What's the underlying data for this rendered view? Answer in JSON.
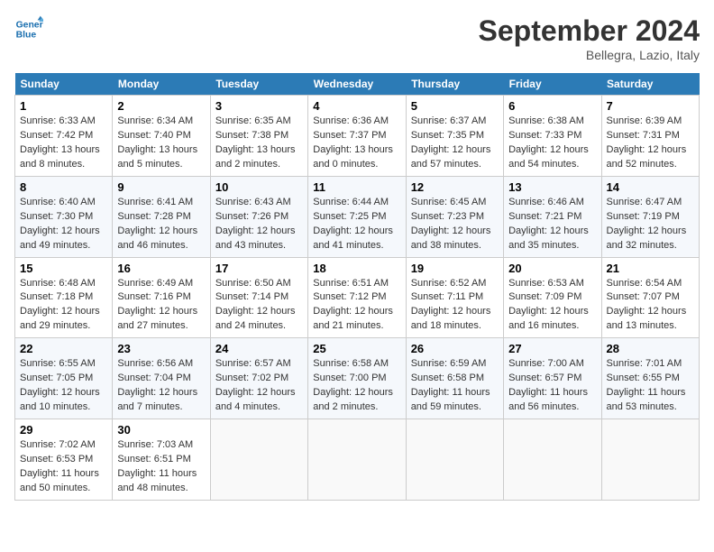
{
  "header": {
    "logo_line1": "General",
    "logo_line2": "Blue",
    "month_title": "September 2024",
    "location": "Bellegra, Lazio, Italy"
  },
  "days_of_week": [
    "Sunday",
    "Monday",
    "Tuesday",
    "Wednesday",
    "Thursday",
    "Friday",
    "Saturday"
  ],
  "weeks": [
    [
      {
        "num": "1",
        "rise": "6:33 AM",
        "set": "7:42 PM",
        "daylight": "13 hours and 8 minutes."
      },
      {
        "num": "2",
        "rise": "6:34 AM",
        "set": "7:40 PM",
        "daylight": "13 hours and 5 minutes."
      },
      {
        "num": "3",
        "rise": "6:35 AM",
        "set": "7:38 PM",
        "daylight": "13 hours and 2 minutes."
      },
      {
        "num": "4",
        "rise": "6:36 AM",
        "set": "7:37 PM",
        "daylight": "13 hours and 0 minutes."
      },
      {
        "num": "5",
        "rise": "6:37 AM",
        "set": "7:35 PM",
        "daylight": "12 hours and 57 minutes."
      },
      {
        "num": "6",
        "rise": "6:38 AM",
        "set": "7:33 PM",
        "daylight": "12 hours and 54 minutes."
      },
      {
        "num": "7",
        "rise": "6:39 AM",
        "set": "7:31 PM",
        "daylight": "12 hours and 52 minutes."
      }
    ],
    [
      {
        "num": "8",
        "rise": "6:40 AM",
        "set": "7:30 PM",
        "daylight": "12 hours and 49 minutes."
      },
      {
        "num": "9",
        "rise": "6:41 AM",
        "set": "7:28 PM",
        "daylight": "12 hours and 46 minutes."
      },
      {
        "num": "10",
        "rise": "6:43 AM",
        "set": "7:26 PM",
        "daylight": "12 hours and 43 minutes."
      },
      {
        "num": "11",
        "rise": "6:44 AM",
        "set": "7:25 PM",
        "daylight": "12 hours and 41 minutes."
      },
      {
        "num": "12",
        "rise": "6:45 AM",
        "set": "7:23 PM",
        "daylight": "12 hours and 38 minutes."
      },
      {
        "num": "13",
        "rise": "6:46 AM",
        "set": "7:21 PM",
        "daylight": "12 hours and 35 minutes."
      },
      {
        "num": "14",
        "rise": "6:47 AM",
        "set": "7:19 PM",
        "daylight": "12 hours and 32 minutes."
      }
    ],
    [
      {
        "num": "15",
        "rise": "6:48 AM",
        "set": "7:18 PM",
        "daylight": "12 hours and 29 minutes."
      },
      {
        "num": "16",
        "rise": "6:49 AM",
        "set": "7:16 PM",
        "daylight": "12 hours and 27 minutes."
      },
      {
        "num": "17",
        "rise": "6:50 AM",
        "set": "7:14 PM",
        "daylight": "12 hours and 24 minutes."
      },
      {
        "num": "18",
        "rise": "6:51 AM",
        "set": "7:12 PM",
        "daylight": "12 hours and 21 minutes."
      },
      {
        "num": "19",
        "rise": "6:52 AM",
        "set": "7:11 PM",
        "daylight": "12 hours and 18 minutes."
      },
      {
        "num": "20",
        "rise": "6:53 AM",
        "set": "7:09 PM",
        "daylight": "12 hours and 16 minutes."
      },
      {
        "num": "21",
        "rise": "6:54 AM",
        "set": "7:07 PM",
        "daylight": "12 hours and 13 minutes."
      }
    ],
    [
      {
        "num": "22",
        "rise": "6:55 AM",
        "set": "7:05 PM",
        "daylight": "12 hours and 10 minutes."
      },
      {
        "num": "23",
        "rise": "6:56 AM",
        "set": "7:04 PM",
        "daylight": "12 hours and 7 minutes."
      },
      {
        "num": "24",
        "rise": "6:57 AM",
        "set": "7:02 PM",
        "daylight": "12 hours and 4 minutes."
      },
      {
        "num": "25",
        "rise": "6:58 AM",
        "set": "7:00 PM",
        "daylight": "12 hours and 2 minutes."
      },
      {
        "num": "26",
        "rise": "6:59 AM",
        "set": "6:58 PM",
        "daylight": "11 hours and 59 minutes."
      },
      {
        "num": "27",
        "rise": "7:00 AM",
        "set": "6:57 PM",
        "daylight": "11 hours and 56 minutes."
      },
      {
        "num": "28",
        "rise": "7:01 AM",
        "set": "6:55 PM",
        "daylight": "11 hours and 53 minutes."
      }
    ],
    [
      {
        "num": "29",
        "rise": "7:02 AM",
        "set": "6:53 PM",
        "daylight": "11 hours and 50 minutes."
      },
      {
        "num": "30",
        "rise": "7:03 AM",
        "set": "6:51 PM",
        "daylight": "11 hours and 48 minutes."
      },
      null,
      null,
      null,
      null,
      null
    ]
  ]
}
